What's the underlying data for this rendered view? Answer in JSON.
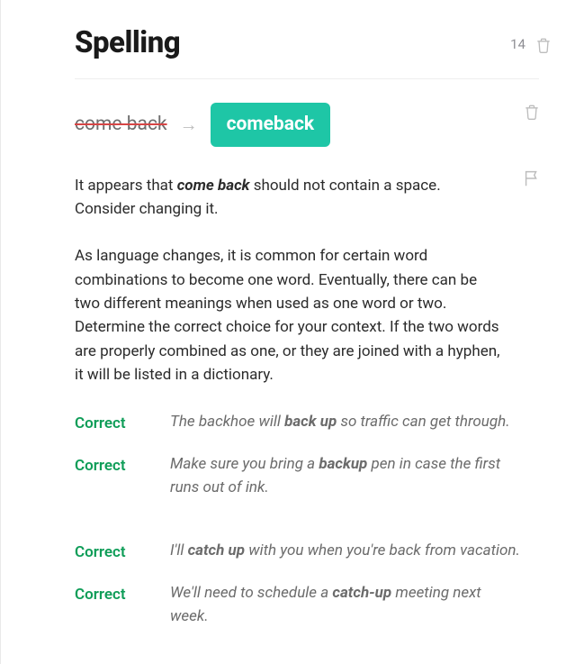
{
  "header": {
    "title": "Spelling",
    "count": "14"
  },
  "correction": {
    "original": "come back",
    "suggestion": "comeback",
    "arrow": "→"
  },
  "paragraphs": {
    "p1_before": "It appears that ",
    "p1_term": "come back",
    "p1_after": " should not contain a space. Consider changing it.",
    "p2": "As language changes, it is common for certain word combinations to become one word. Eventually, there can be two different meanings when used as one word or two. Determine the correct choice for your context. If the two words are properly combined as one, or they are joined with a hyphen, it will be listed in a dictionary."
  },
  "ex_label": "Correct",
  "examples": {
    "e1": {
      "pre": "The backhoe will ",
      "bold": "back up",
      "post": " so traffic can get through."
    },
    "e2": {
      "pre": "Make sure you bring a ",
      "bold": "backup",
      "post": " pen in case the first runs out of ink."
    },
    "e3": {
      "pre": "I'll ",
      "bold": "catch up",
      "post": " with you when you're back from vacation."
    },
    "e4": {
      "pre": "We'll need to schedule a ",
      "bold": "catch-up",
      "post": " meeting next week."
    }
  }
}
